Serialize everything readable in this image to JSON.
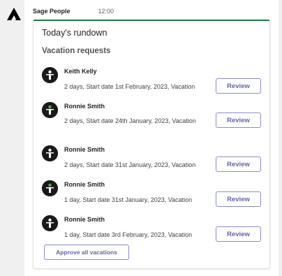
{
  "message": {
    "sender": "Sage People",
    "time": "12:00",
    "bot_icon": "sage-logo-icon"
  },
  "card": {
    "title": "Today's rundown",
    "section_title": "Vacation requests",
    "items": [
      {
        "name": "Keith Kelly",
        "description": "2 days, Start date 1st February, 2023, Vacation",
        "action": "Review",
        "avatar_icon": "person-icon",
        "avatar_color": "#1a1a1a",
        "figure_color": "#ffffff"
      },
      {
        "name": "Ronnie Smith",
        "description": "2 days, Start date 24th January, 2023, Vacation",
        "action": "Review",
        "avatar_icon": "person-icon",
        "avatar_color": "#1a1a1a",
        "figure_color": "#ffffff",
        "head_color": "#4caf50"
      },
      {
        "name": "Ronnie Smith",
        "description": "2 days, Start date 31st January, 2023, Vacation",
        "action": "Review",
        "avatar_icon": "person-icon",
        "avatar_color": "#1a1a1a",
        "figure_color": "#ffffff"
      },
      {
        "name": "Ronnie Smith",
        "description": "1 day, Start date 31st January, 2023, Vacation",
        "action": "Review",
        "avatar_icon": "person-icon",
        "avatar_color": "#1a1a1a",
        "figure_color": "#ffffff",
        "head_color": "#4caf50"
      },
      {
        "name": "Ronnie Smith",
        "description": "1 day, Start date 3rd February, 2023, Vacation",
        "action": "Review",
        "avatar_icon": "person-icon",
        "avatar_color": "#1a1a1a",
        "figure_color": "#ffffff"
      }
    ],
    "approve_all_label": "Approve all vacations"
  },
  "colors": {
    "accent": "#6264a7",
    "card_top_border": "#1e7a48",
    "background": "#f0f0f0"
  }
}
